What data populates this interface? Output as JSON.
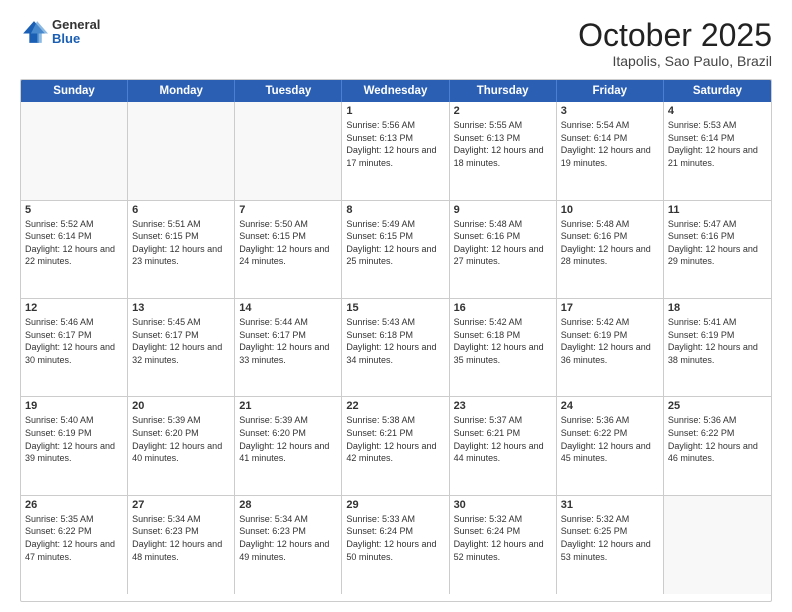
{
  "header": {
    "logo": {
      "general": "General",
      "blue": "Blue"
    },
    "title": "October 2025",
    "location": "Itapolis, Sao Paulo, Brazil"
  },
  "days": [
    "Sunday",
    "Monday",
    "Tuesday",
    "Wednesday",
    "Thursday",
    "Friday",
    "Saturday"
  ],
  "rows": [
    [
      {
        "day": "",
        "empty": true
      },
      {
        "day": "",
        "empty": true
      },
      {
        "day": "",
        "empty": true
      },
      {
        "day": "1",
        "rise": "5:56 AM",
        "set": "6:13 PM",
        "daylight": "12 hours and 17 minutes."
      },
      {
        "day": "2",
        "rise": "5:55 AM",
        "set": "6:13 PM",
        "daylight": "12 hours and 18 minutes."
      },
      {
        "day": "3",
        "rise": "5:54 AM",
        "set": "6:14 PM",
        "daylight": "12 hours and 19 minutes."
      },
      {
        "day": "4",
        "rise": "5:53 AM",
        "set": "6:14 PM",
        "daylight": "12 hours and 21 minutes."
      }
    ],
    [
      {
        "day": "5",
        "rise": "5:52 AM",
        "set": "6:14 PM",
        "daylight": "12 hours and 22 minutes."
      },
      {
        "day": "6",
        "rise": "5:51 AM",
        "set": "6:15 PM",
        "daylight": "12 hours and 23 minutes."
      },
      {
        "day": "7",
        "rise": "5:50 AM",
        "set": "6:15 PM",
        "daylight": "12 hours and 24 minutes."
      },
      {
        "day": "8",
        "rise": "5:49 AM",
        "set": "6:15 PM",
        "daylight": "12 hours and 25 minutes."
      },
      {
        "day": "9",
        "rise": "5:48 AM",
        "set": "6:16 PM",
        "daylight": "12 hours and 27 minutes."
      },
      {
        "day": "10",
        "rise": "5:48 AM",
        "set": "6:16 PM",
        "daylight": "12 hours and 28 minutes."
      },
      {
        "day": "11",
        "rise": "5:47 AM",
        "set": "6:16 PM",
        "daylight": "12 hours and 29 minutes."
      }
    ],
    [
      {
        "day": "12",
        "rise": "5:46 AM",
        "set": "6:17 PM",
        "daylight": "12 hours and 30 minutes."
      },
      {
        "day": "13",
        "rise": "5:45 AM",
        "set": "6:17 PM",
        "daylight": "12 hours and 32 minutes."
      },
      {
        "day": "14",
        "rise": "5:44 AM",
        "set": "6:17 PM",
        "daylight": "12 hours and 33 minutes."
      },
      {
        "day": "15",
        "rise": "5:43 AM",
        "set": "6:18 PM",
        "daylight": "12 hours and 34 minutes."
      },
      {
        "day": "16",
        "rise": "5:42 AM",
        "set": "6:18 PM",
        "daylight": "12 hours and 35 minutes."
      },
      {
        "day": "17",
        "rise": "5:42 AM",
        "set": "6:19 PM",
        "daylight": "12 hours and 36 minutes."
      },
      {
        "day": "18",
        "rise": "5:41 AM",
        "set": "6:19 PM",
        "daylight": "12 hours and 38 minutes."
      }
    ],
    [
      {
        "day": "19",
        "rise": "5:40 AM",
        "set": "6:19 PM",
        "daylight": "12 hours and 39 minutes."
      },
      {
        "day": "20",
        "rise": "5:39 AM",
        "set": "6:20 PM",
        "daylight": "12 hours and 40 minutes."
      },
      {
        "day": "21",
        "rise": "5:39 AM",
        "set": "6:20 PM",
        "daylight": "12 hours and 41 minutes."
      },
      {
        "day": "22",
        "rise": "5:38 AM",
        "set": "6:21 PM",
        "daylight": "12 hours and 42 minutes."
      },
      {
        "day": "23",
        "rise": "5:37 AM",
        "set": "6:21 PM",
        "daylight": "12 hours and 44 minutes."
      },
      {
        "day": "24",
        "rise": "5:36 AM",
        "set": "6:22 PM",
        "daylight": "12 hours and 45 minutes."
      },
      {
        "day": "25",
        "rise": "5:36 AM",
        "set": "6:22 PM",
        "daylight": "12 hours and 46 minutes."
      }
    ],
    [
      {
        "day": "26",
        "rise": "5:35 AM",
        "set": "6:22 PM",
        "daylight": "12 hours and 47 minutes."
      },
      {
        "day": "27",
        "rise": "5:34 AM",
        "set": "6:23 PM",
        "daylight": "12 hours and 48 minutes."
      },
      {
        "day": "28",
        "rise": "5:34 AM",
        "set": "6:23 PM",
        "daylight": "12 hours and 49 minutes."
      },
      {
        "day": "29",
        "rise": "5:33 AM",
        "set": "6:24 PM",
        "daylight": "12 hours and 50 minutes."
      },
      {
        "day": "30",
        "rise": "5:32 AM",
        "set": "6:24 PM",
        "daylight": "12 hours and 52 minutes."
      },
      {
        "day": "31",
        "rise": "5:32 AM",
        "set": "6:25 PM",
        "daylight": "12 hours and 53 minutes."
      },
      {
        "day": "",
        "empty": true
      }
    ]
  ]
}
